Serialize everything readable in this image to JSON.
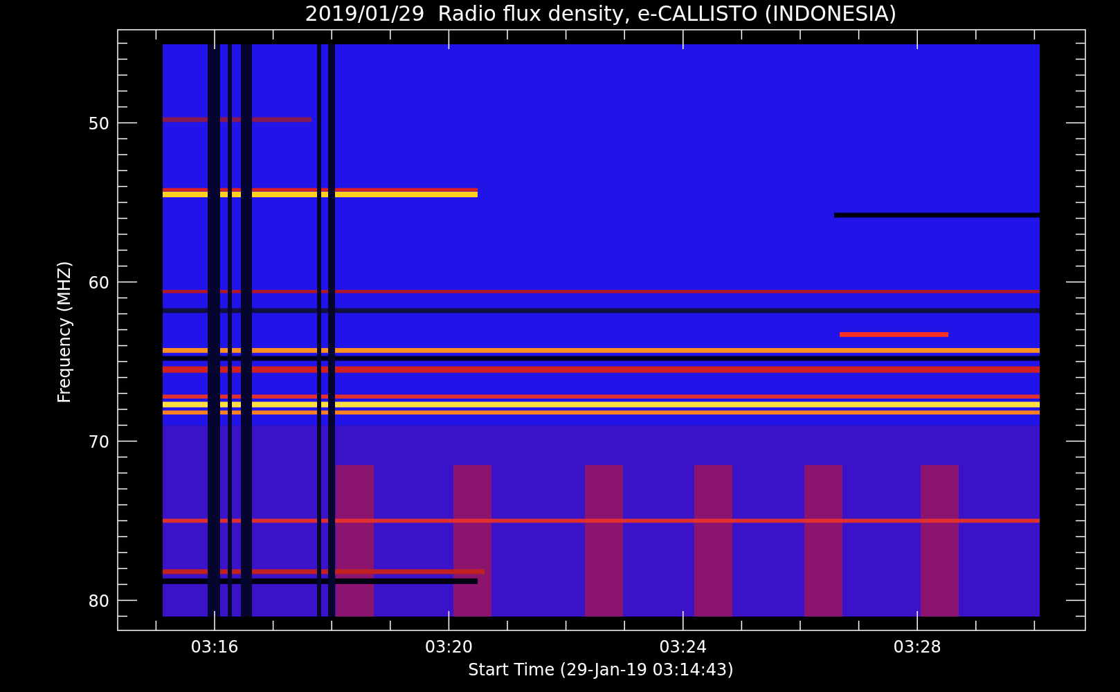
{
  "title": "2019/01/29  Radio flux density, e-CALLISTO (INDONESIA)",
  "y_axis": {
    "label": "Frequency (MHZ)",
    "ticks": [
      "50",
      "60",
      "70",
      "80"
    ]
  },
  "x_axis": {
    "label": "Start Time (29-Jan-19 03:14:43)",
    "ticks": [
      "03:16",
      "03:20",
      "03:24",
      "03:28"
    ]
  }
}
